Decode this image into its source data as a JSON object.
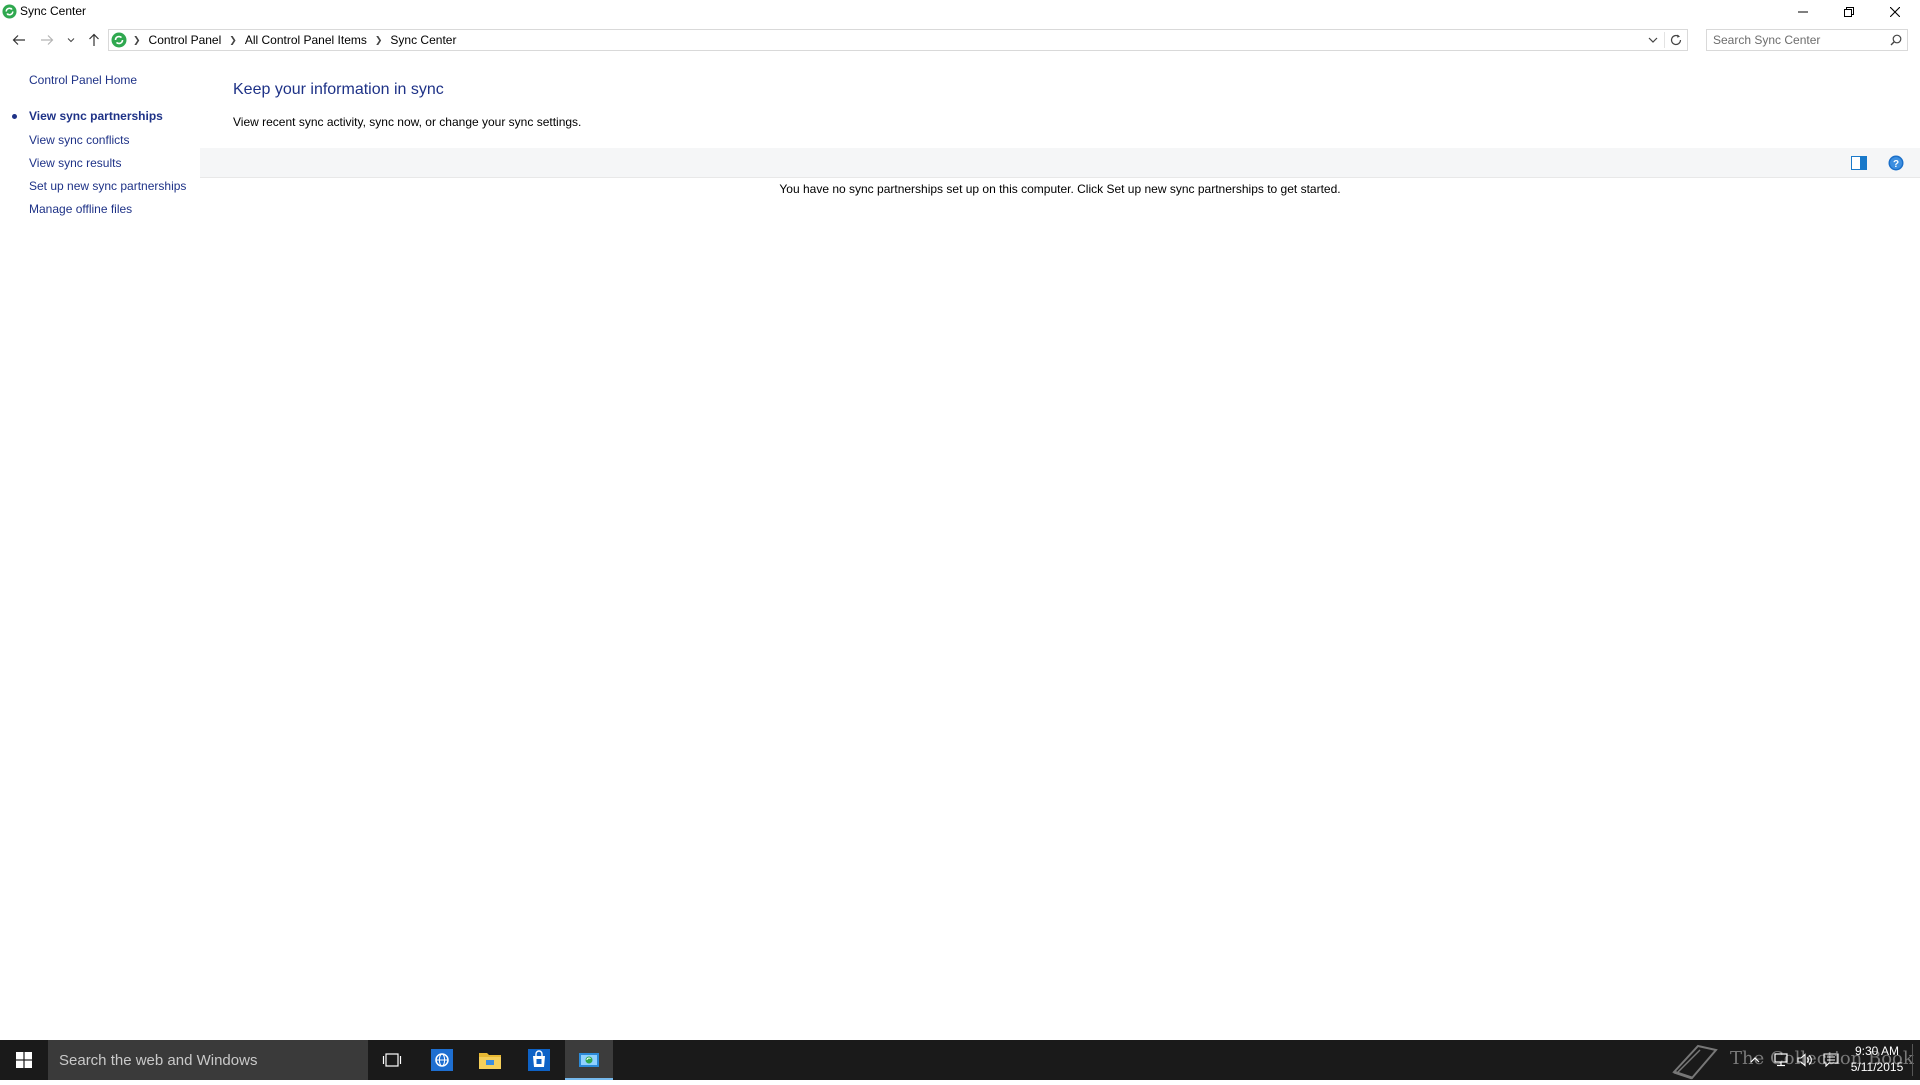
{
  "window": {
    "title": "Sync Center"
  },
  "address_bar": {
    "breadcrumbs": [
      "Control Panel",
      "All Control Panel Items",
      "Sync Center"
    ]
  },
  "search": {
    "placeholder": "Search Sync Center"
  },
  "sidebar": {
    "home_label": "Control Panel Home",
    "items": [
      {
        "label": "View sync partnerships",
        "active": true
      },
      {
        "label": "View sync conflicts"
      },
      {
        "label": "View sync results"
      },
      {
        "label": "Set up new sync partnerships"
      },
      {
        "label": "Manage offline files"
      }
    ]
  },
  "main": {
    "heading": "Keep your information in sync",
    "description": "View recent sync activity, sync now, or change your sync settings.",
    "empty_message": "You have no sync partnerships set up on this computer. Click Set up new sync partnerships to get started."
  },
  "taskbar": {
    "search_label": "Search the web and Windows",
    "apps": [
      "task-view-icon",
      "internet-explorer-icon",
      "file-explorer-icon",
      "store-icon",
      "sync-center-icon"
    ],
    "watermark": "The Collection Book",
    "clock": {
      "time": "9:30 AM",
      "date": "5/11/2015"
    }
  },
  "colors": {
    "link": "#1e3287",
    "taskbar": "#1a1a1a",
    "taskbar_search": "#3a3a3a",
    "active_accent": "#76b9ed"
  }
}
